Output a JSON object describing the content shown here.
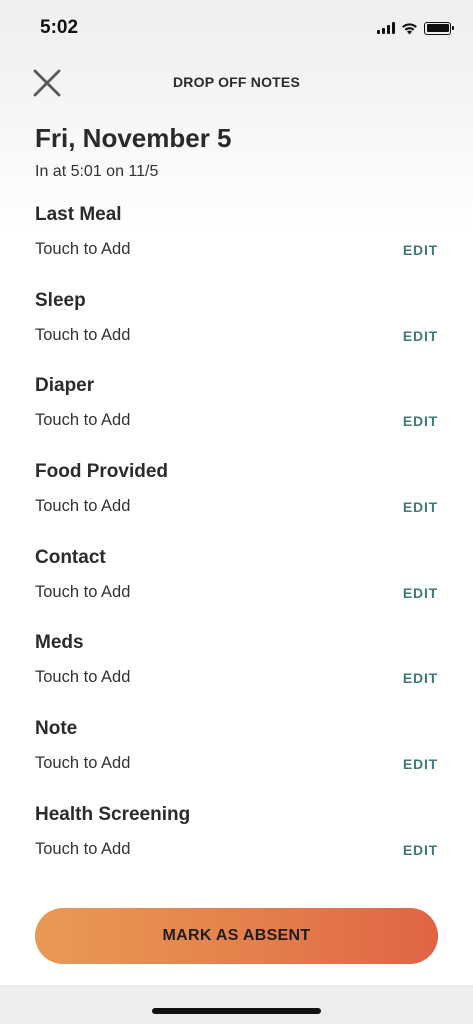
{
  "status_bar": {
    "time": "5:02",
    "icons": [
      "cellular-signal-icon",
      "wifi-icon",
      "battery-icon"
    ]
  },
  "header": {
    "title": "DROP OFF NOTES",
    "close_icon": "close-icon"
  },
  "summary": {
    "date": "Fri, November 5",
    "checkin": "In at 5:01 on 11/5"
  },
  "notes": [
    {
      "label": "Last Meal",
      "value": "Touch to Add",
      "action": "EDIT"
    },
    {
      "label": "Sleep",
      "value": "Touch to Add",
      "action": "EDIT"
    },
    {
      "label": "Diaper",
      "value": "Touch to Add",
      "action": "EDIT"
    },
    {
      "label": "Food Provided",
      "value": "Touch to Add",
      "action": "EDIT"
    },
    {
      "label": "Contact",
      "value": "Touch to Add",
      "action": "EDIT"
    },
    {
      "label": "Meds",
      "value": "Touch to Add",
      "action": "EDIT"
    },
    {
      "label": "Note",
      "value": "Touch to Add",
      "action": "EDIT"
    },
    {
      "label": "Health Screening",
      "value": "Touch to Add",
      "action": "EDIT"
    }
  ],
  "footer": {
    "absent_button": "MARK AS ABSENT"
  },
  "colors": {
    "accent_edit": "#3f7a7a",
    "button_start": "#e89a55",
    "button_end": "#df6444"
  }
}
